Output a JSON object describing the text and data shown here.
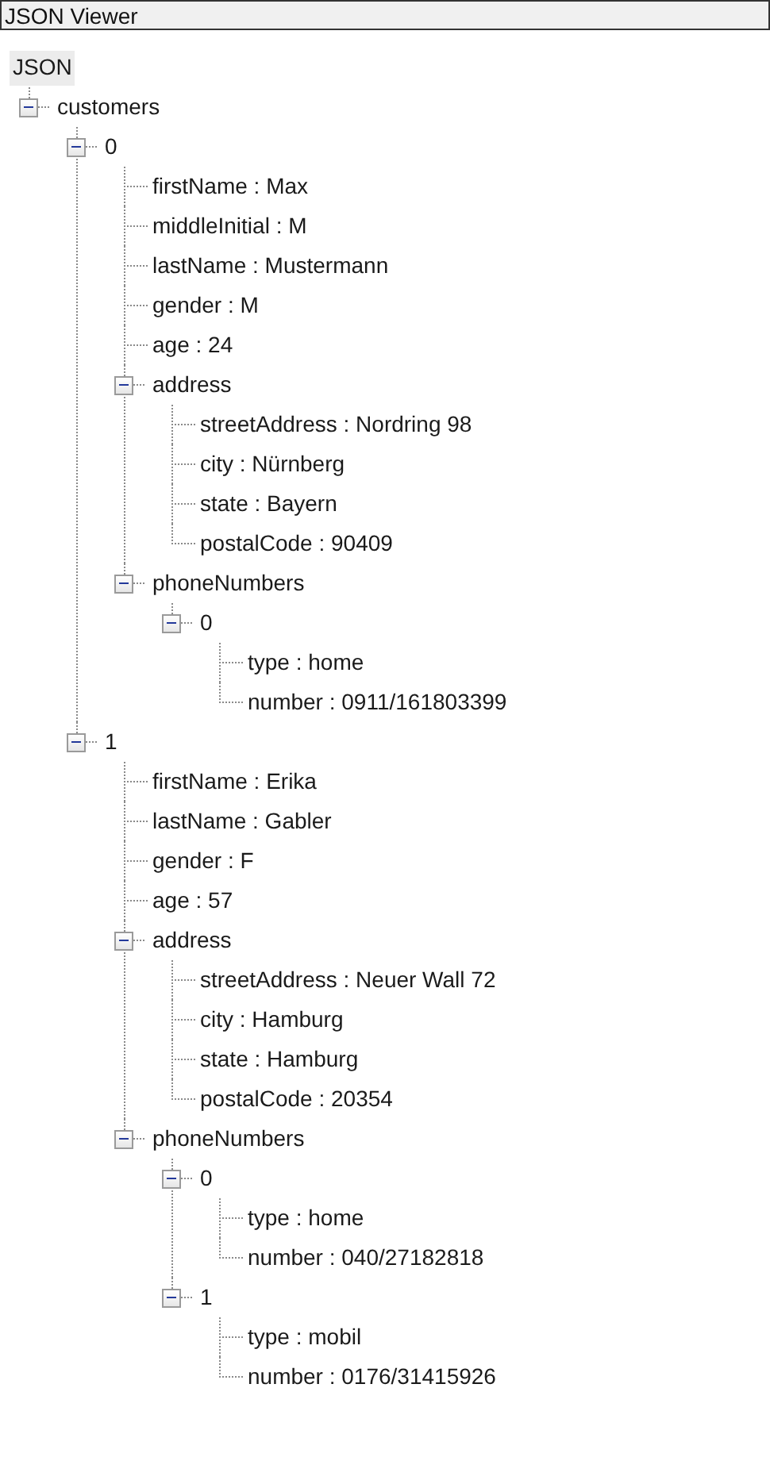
{
  "window": {
    "title": "JSON Viewer"
  },
  "tree": {
    "label": "JSON",
    "children": [
      {
        "label": "customers",
        "expanded": true,
        "children": [
          {
            "label": "0",
            "expanded": true,
            "children": [
              {
                "label": "firstName : Max"
              },
              {
                "label": "middleInitial : M"
              },
              {
                "label": "lastName : Mustermann"
              },
              {
                "label": "gender : M"
              },
              {
                "label": "age : 24"
              },
              {
                "label": "address",
                "expanded": true,
                "children": [
                  {
                    "label": "streetAddress : Nordring 98"
                  },
                  {
                    "label": "city : Nürnberg"
                  },
                  {
                    "label": "state : Bayern"
                  },
                  {
                    "label": "postalCode : 90409"
                  }
                ]
              },
              {
                "label": "phoneNumbers",
                "expanded": true,
                "children": [
                  {
                    "label": "0",
                    "expanded": true,
                    "children": [
                      {
                        "label": "type : home"
                      },
                      {
                        "label": "number : 0911/161803399"
                      }
                    ]
                  }
                ]
              }
            ]
          },
          {
            "label": "1",
            "expanded": true,
            "children": [
              {
                "label": "firstName : Erika"
              },
              {
                "label": "lastName : Gabler"
              },
              {
                "label": "gender : F"
              },
              {
                "label": "age : 57"
              },
              {
                "label": "address",
                "expanded": true,
                "children": [
                  {
                    "label": "streetAddress : Neuer Wall 72"
                  },
                  {
                    "label": "city : Hamburg"
                  },
                  {
                    "label": "state : Hamburg"
                  },
                  {
                    "label": "postalCode : 20354"
                  }
                ]
              },
              {
                "label": "phoneNumbers",
                "expanded": true,
                "children": [
                  {
                    "label": "0",
                    "expanded": true,
                    "children": [
                      {
                        "label": "type : home"
                      },
                      {
                        "label": "number : 040/27182818"
                      }
                    ]
                  },
                  {
                    "label": "1",
                    "expanded": true,
                    "children": [
                      {
                        "label": "type : mobil"
                      },
                      {
                        "label": "number : 0176/31415926"
                      }
                    ]
                  }
                ]
              }
            ]
          }
        ]
      }
    ]
  }
}
